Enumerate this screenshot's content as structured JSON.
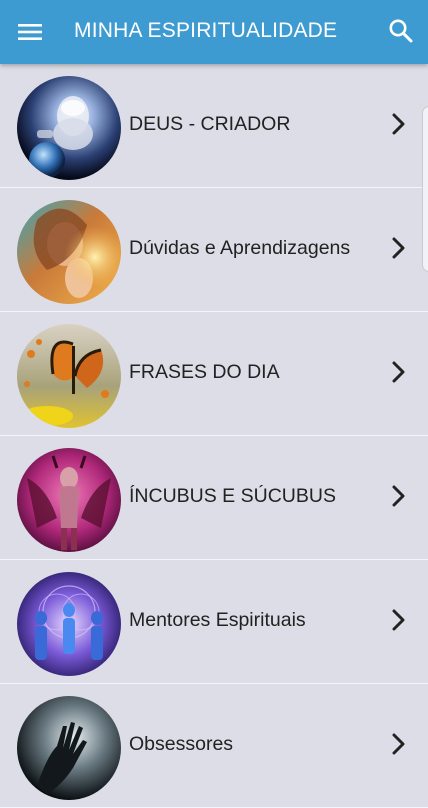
{
  "appbar": {
    "title": "MINHA ESPIRITUALIDADE",
    "menu_icon": "hamburger-menu-icon",
    "search_icon": "search-icon",
    "color": "#3e9bd2"
  },
  "list": {
    "items": [
      {
        "label": "DEUS - CRIADOR",
        "image": "god-creator-thumbnail"
      },
      {
        "label": "Dúvidas e Aprendizagens",
        "image": "praying-woman-thumbnail"
      },
      {
        "label": "FRASES DO DIA",
        "image": "butterflies-thumbnail"
      },
      {
        "label": "ÍNCUBUS E SÚCUBUS",
        "image": "demon-figure-thumbnail"
      },
      {
        "label": "Mentores Espirituais",
        "image": "spirit-mentors-thumbnail"
      },
      {
        "label": "Obsessores",
        "image": "dark-hand-thumbnail"
      }
    ],
    "chevron_icon": "chevron-right-icon",
    "background": "#dcdde6"
  }
}
